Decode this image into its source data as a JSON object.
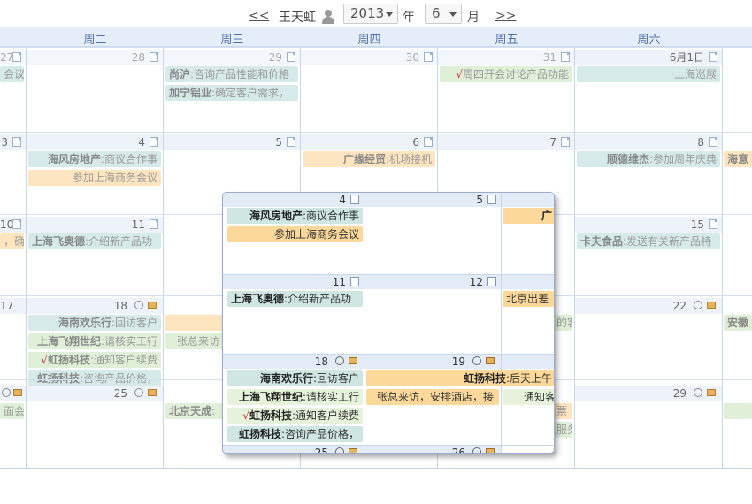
{
  "toolbar": {
    "prev": "<<",
    "next": ">>",
    "user": "王天虹",
    "year": "2013",
    "year_label": "年",
    "month": "6",
    "month_label": "月"
  },
  "weekdays": [
    "周二",
    "周三",
    "周四",
    "周五",
    "周六"
  ],
  "weeks": [
    {
      "days": [
        "27",
        "28",
        "29",
        "30",
        "31",
        "6月1日"
      ],
      "events": [
        {
          "id": "w1a",
          "text": "会议"
        },
        {
          "id": "w1b",
          "bold": "尚沪",
          "text": ":咨询产品性能和价格"
        },
        {
          "id": "w1c",
          "bold": "加宁铝业",
          "text": ":确定客户需求，"
        },
        {
          "id": "w1d",
          "check": "√",
          "text": "周四开会讨论产品功能"
        },
        {
          "id": "w1e",
          "text": "上海巡展"
        }
      ]
    },
    {
      "days": [
        "3",
        "4",
        "5",
        "6",
        "7",
        "8"
      ],
      "events": [
        {
          "id": "w2a",
          "bold": "海风房地产",
          "text": ":商议合作事"
        },
        {
          "id": "w2b",
          "text": "参加上海商务会议"
        },
        {
          "id": "w2c",
          "bold": "广缘经贸",
          "text": ":机场接机"
        },
        {
          "id": "w2d",
          "bold": "顺德维杰",
          "text": ":参加周年庆典"
        },
        {
          "id": "w2e",
          "bold": "海意",
          "text": ""
        }
      ]
    },
    {
      "days": [
        "10",
        "11",
        "15"
      ],
      "events": [
        {
          "id": "w3a",
          "text": "，确"
        },
        {
          "id": "w3b",
          "bold": "上海飞奥德",
          "text": ":介绍新产品功"
        },
        {
          "id": "w3c",
          "bold": "卡夫食品",
          "text": ":发送有关新产品特"
        }
      ]
    },
    {
      "days": [
        "17",
        "18",
        "22"
      ],
      "events": [
        {
          "id": "w4a",
          "bold": "海南欢乐行",
          "text": ":回访客户"
        },
        {
          "id": "w4b",
          "bold": "上海飞翔世纪",
          "text": ":请核实工行"
        },
        {
          "id": "w4c",
          "check": "√",
          "bold": "虹扬科技",
          "text": ":通知客户续费"
        },
        {
          "id": "w4d",
          "bold": "虹扬科技",
          "text": ":咨询产品价格，"
        },
        {
          "id": "w4e",
          "text": "张总来访"
        },
        {
          "id": "w4f",
          "text": "的客"
        },
        {
          "id": "w4g",
          "bold": "安徽",
          "text": ""
        }
      ]
    },
    {
      "days": [
        "25",
        "29"
      ],
      "events": [
        {
          "id": "w5a",
          "text": "面会"
        },
        {
          "id": "w5b",
          "bold": "北京天成",
          "text": ":"
        },
        {
          "id": "w5c",
          "text": "票"
        },
        {
          "id": "w5d",
          "text": "服务"
        }
      ]
    }
  ],
  "popup": {
    "days": [
      "4",
      "5",
      "11",
      "12",
      "18",
      "19",
      "25",
      "26"
    ],
    "events": [
      {
        "id": "p1",
        "bold": "海风房地产",
        "text": ":商议合作事"
      },
      {
        "id": "p2",
        "text": "参加上海商务会议"
      },
      {
        "id": "p3",
        "bold": "广",
        "text": ""
      },
      {
        "id": "p4",
        "bold": "上海飞奥德",
        "text": ":介绍新产品功"
      },
      {
        "id": "p5",
        "text": "北京出差"
      },
      {
        "id": "p6",
        "bold": "海南欢乐行",
        "text": ":回访客户"
      },
      {
        "id": "p7",
        "bold": "虹扬科技",
        "text": ":后天上午"
      },
      {
        "id": "p8",
        "bold": "上海飞翔世纪",
        "text": ":请核实工行"
      },
      {
        "id": "p9",
        "text": "张总来访，安排酒店，接"
      },
      {
        "id": "p10",
        "text": "通知客"
      },
      {
        "id": "p11",
        "check": "√",
        "bold": "虹扬科技",
        "text": ":通知客户续费"
      },
      {
        "id": "p12",
        "bold": "虹扬科技",
        "text": ":咨询产品价格，"
      }
    ]
  }
}
